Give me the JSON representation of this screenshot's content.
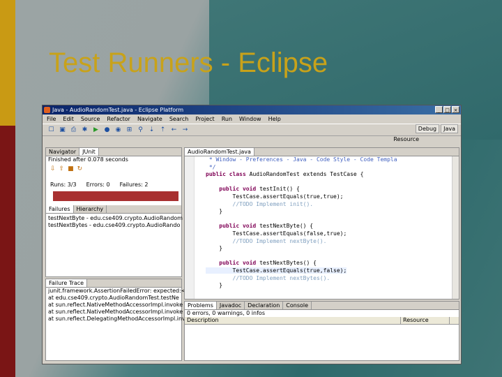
{
  "slide_title": "Test Runners - Eclipse",
  "window_title": "Java - AudioRandomTest.java - Eclipse Platform",
  "window_buttons": [
    "_",
    "□",
    "×"
  ],
  "menu": [
    "File",
    "Edit",
    "Source",
    "Refactor",
    "Navigate",
    "Search",
    "Project",
    "Run",
    "Window",
    "Help"
  ],
  "perspectives": [
    "Debug",
    "Java"
  ],
  "resource_label": "Resource",
  "left_tabs": [
    "Navigator",
    "JUnit"
  ],
  "junit": {
    "status": "Finished after 0.078 seconds",
    "runs_label": "Runs:",
    "runs": "3/3",
    "errors_label": "Errors:",
    "errors": "0",
    "failures_label": "Failures:",
    "failures": "2",
    "bar_color": "#a83030"
  },
  "result_tabs": [
    "Failures",
    "Hierarchy"
  ],
  "failures": [
    "testNextByte - edu.cse409.crypto.AudioRandom",
    "testNextBytes - edu.cse409.crypto.AudioRando"
  ],
  "trace_label": "Failure Trace",
  "trace": [
    "junit.framework.AssertionFailedError: expected:<",
    "at edu.cse409.crypto.AudioRandomTest.testNe",
    "at sun.reflect.NativeMethodAccessorImpl.invoke",
    "at sun.reflect.NativeMethodAccessorImpl.invoke",
    "at sun.reflect.DelegatingMethodAccessorImpl.inv"
  ],
  "editor_tab": "AudioRandomTest.java",
  "code": {
    "l1": " * Window - Preferences - Java - Code Style - Code Templa",
    "l2": " */",
    "l3_kw": "public class ",
    "l3_rest": "AudioRandomTest extends TestCase {",
    "m1_kw": "    public void ",
    "m1_rest": "testInit() {",
    "m1_body": "        TestCase.assertEquals(true,true);",
    "m1_todo": "        //TODO Implement init().",
    "close": "    }",
    "m2_kw": "    public void ",
    "m2_rest": "testNextByte() {",
    "m2_body": "        TestCase.assertEquals(false,true);",
    "m2_todo": "        //TODO Implement nextByte().",
    "m3_kw": "    public void ",
    "m3_rest": "testNextBytes() {",
    "m3_body": "        TestCase.assertEquals(true,false);",
    "m3_todo": "        //TODO Implement nextBytes()."
  },
  "bottom_tabs": [
    "Problems",
    "Javadoc",
    "Declaration",
    "Console"
  ],
  "problems_summary": "0 errors, 0 warnings, 0 infos",
  "problems_cols": [
    "Description",
    "Resource"
  ]
}
